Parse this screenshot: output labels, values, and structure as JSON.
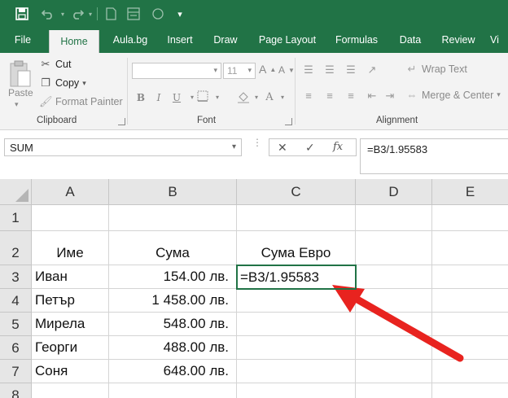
{
  "accent": "#217346",
  "qat": {
    "icons": [
      "save-icon",
      "undo-icon",
      "redo-icon",
      "new-file-icon",
      "print-preview-icon",
      "shape-icon",
      "customize-qat-icon"
    ]
  },
  "tabs": [
    "File",
    "Home",
    "Aula.bg",
    "Insert",
    "Draw",
    "Page Layout",
    "Formulas",
    "Data",
    "Review",
    "Vi"
  ],
  "active_tab": "Home",
  "ribbon": {
    "clipboard": {
      "paste_label": "Paste",
      "cut_label": "Cut",
      "copy_label": "Copy",
      "format_painter_label": "Format Painter",
      "group_label": "Clipboard"
    },
    "font": {
      "font_name": "",
      "font_size": "11",
      "bold": "B",
      "italic": "I",
      "underline": "U",
      "group_label": "Font"
    },
    "alignment": {
      "wrap_text_label": "Wrap Text",
      "merge_center_label": "Merge & Center",
      "group_label": "Alignment"
    }
  },
  "formula_bar": {
    "name_box": "SUM",
    "cancel": "✕",
    "enter": "✓",
    "fx": "fx",
    "formula": "=B3/1.95583"
  },
  "columns": [
    "A",
    "B",
    "C",
    "D",
    "E"
  ],
  "rows": [
    "1",
    "2",
    "3",
    "4",
    "5",
    "6",
    "7",
    "8"
  ],
  "cells": {
    "headers": {
      "a2": "Име",
      "b2": "Сума",
      "c2": "Сума Евро"
    },
    "data": [
      {
        "row": "3",
        "name": "Иван",
        "amount": "154.00 лв.",
        "euro": "=B3/1.95583"
      },
      {
        "row": "4",
        "name": "Петър",
        "amount": "1 458.00 лв.",
        "euro": ""
      },
      {
        "row": "5",
        "name": "Мирела",
        "amount": "548.00 лв.",
        "euro": ""
      },
      {
        "row": "6",
        "name": "Георги",
        "amount": "488.00 лв.",
        "euro": ""
      },
      {
        "row": "7",
        "name": "Соня",
        "amount": "648.00 лв.",
        "euro": ""
      }
    ]
  },
  "annotation_arrow_color": "#e8231f"
}
